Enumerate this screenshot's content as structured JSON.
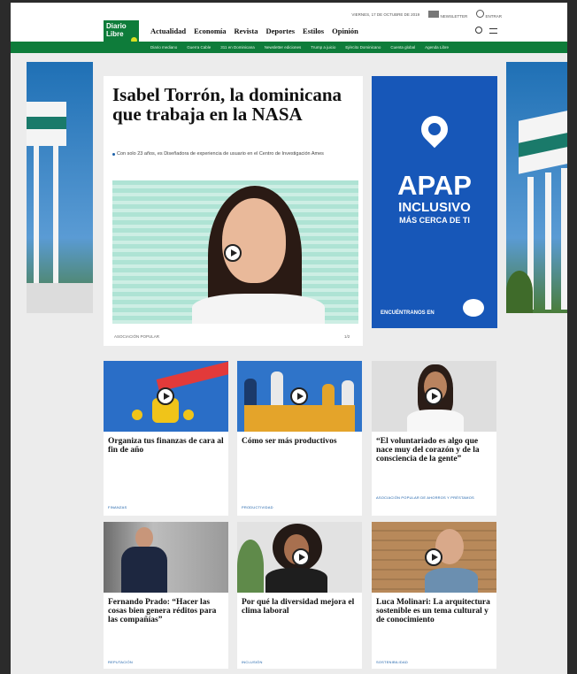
{
  "header": {
    "logo_line1": "Diario",
    "logo_line2": "Libre",
    "nav": [
      "Actualidad",
      "Economía",
      "Revista",
      "Deportes",
      "Estilos",
      "Opinión"
    ],
    "util_date": "VIERNES, 17 DE OCTUBRE DE 2019",
    "util_newsletter": "NEWSLETTER",
    "util_login": "ENTRAR",
    "subnav": [
      "Diario mediano",
      "Guerra Cable",
      "311 en Dominicana",
      "Newsletter ediciones",
      "Trump a juicio",
      "Ejército Dominicano",
      "Cuenta global",
      "Agenda Libre"
    ]
  },
  "hero": {
    "title": "Isabel Torrón, la dominicana que trabaja en la NASA",
    "subtitle": "Con solo 23 años, es Diseñadora de experiencia de usuario en el Centro de Investigación Ames",
    "section": "ASOCIACIÓN POPULAR",
    "right_meta": "1/2"
  },
  "ad": {
    "brand": "APAP",
    "line2": "INCLUSIVO",
    "line3": "MÁS CERCA DE TI",
    "cta": "ENCUÉNTRANOS EN"
  },
  "cards": [
    {
      "title": "Organiza tus finanzas de cara al fin de año",
      "section": "FINANZAS"
    },
    {
      "title": "Cómo ser más productivos",
      "section": "PRODUCTIVIDAD"
    },
    {
      "title": "“El voluntariado es algo que nace muy del corazón y de la consciencia de la gente”",
      "section": "ASOCIACIÓN POPULAR DE AHORROS Y PRÉSTAMOS"
    },
    {
      "title": "Fernando Prado: “Hacer las cosas bien genera réditos para las compañías”",
      "section": "REPUTACIÓN"
    },
    {
      "title": "Por qué la diversidad mejora el clima laboral",
      "section": "INCLUSIÓN"
    },
    {
      "title": "Luca Molinari: La arquitectura sostenible es un tema cultural y de conocimiento",
      "section": "SOSTENIBILIDAD"
    }
  ],
  "colors": {
    "brand_green": "#0e7c3a",
    "ad_blue": "#1757b8",
    "section_blue": "#1a5fa8"
  }
}
